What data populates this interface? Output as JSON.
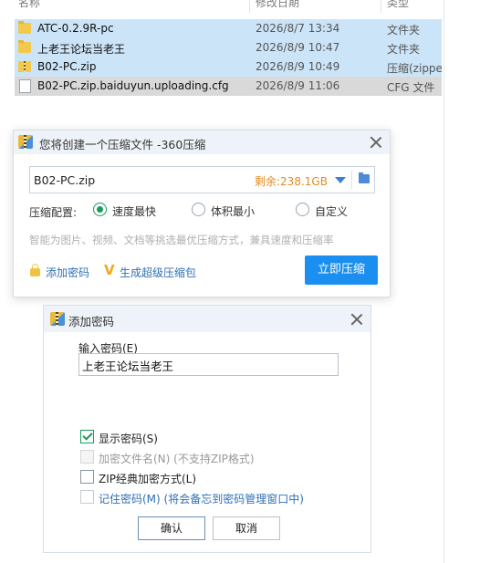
{
  "explorer": {
    "columns": {
      "name": "名称",
      "date": "修改日期",
      "type": "类型"
    },
    "files": [
      {
        "name": "ATC-0.2.9R-pc",
        "date": "2026/8/7 13:34",
        "type": "文件夹",
        "icon": "folder-icon"
      },
      {
        "name": "上老王论坛当老王",
        "date": "2026/8/9 10:47",
        "type": "文件夹",
        "icon": "folder-icon"
      },
      {
        "name": "B02-PC.zip",
        "date": "2026/8/9 10:49",
        "type": "压缩(zipped)",
        "icon": "zip-icon"
      },
      {
        "name": "B02-PC.zip.baiduyun.uploading.cfg",
        "date": "2026/8/9 11:06",
        "type": "CFG 文件",
        "icon": "file-icon"
      }
    ]
  },
  "compress_dialog": {
    "title": "您将创建一个压缩文件 -360压缩",
    "filename": "B02-PC.zip",
    "free_space": "剩余:238.1GB",
    "config_label": "压缩配置:",
    "options": [
      {
        "label": "速度最快",
        "selected": true
      },
      {
        "label": "体积最小",
        "selected": false
      },
      {
        "label": "自定义",
        "selected": false
      }
    ],
    "hint": "智能为图片、视频、文档等挑选最优压缩方式，兼具速度和压缩率",
    "add_password_link": "添加密码",
    "super_archive_link": "生成超级压缩包",
    "start_button": "立即压缩",
    "accent_color": "#1b8ff0"
  },
  "password_dialog": {
    "title": "添加密码",
    "input_label": "输入密码(E)",
    "password_value": "上老王论坛当老王",
    "options": [
      {
        "label": "显示密码(S)",
        "note": "",
        "checked": true,
        "disabled": false
      },
      {
        "label": "加密文件名(N)",
        "note": "(不支持ZIP格式)",
        "checked": false,
        "disabled": true
      },
      {
        "label": "ZIP经典加密方式(L)",
        "note": "",
        "checked": false,
        "disabled": false
      },
      {
        "label": "记住密码(M)",
        "note": "(将会备忘到密码管理窗口中)",
        "checked": false,
        "disabled": false
      }
    ],
    "ok_button": "确认",
    "cancel_button": "取消"
  }
}
